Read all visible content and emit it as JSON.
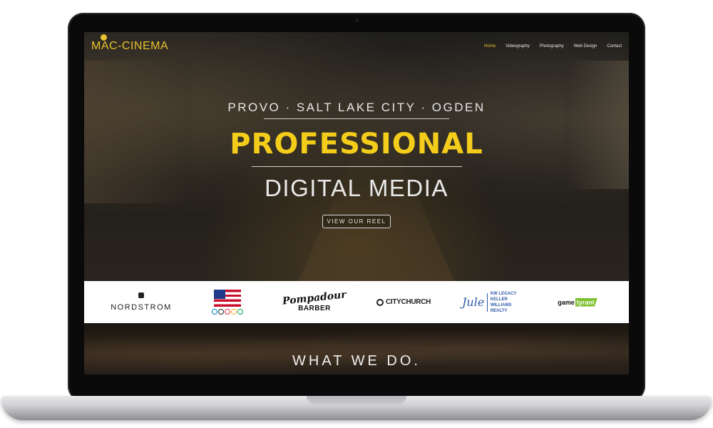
{
  "site": {
    "logo_text": "MAC-CINEMA",
    "nav": [
      {
        "label": "Home",
        "active": true
      },
      {
        "label": "Videography",
        "active": false
      },
      {
        "label": "Photography",
        "active": false
      },
      {
        "label": "Web Design",
        "active": false
      },
      {
        "label": "Contact",
        "active": false
      }
    ]
  },
  "hero": {
    "cities": "PROVO · SALT LAKE CITY · OGDEN",
    "headline": "PROFESSIONAL",
    "subhead": "DIGITAL MEDIA",
    "button_label": "VIEW OUR REEL"
  },
  "clients": {
    "nordstrom": "NORDSTROM",
    "barber_script": "Pompadour",
    "barber_word": "BARBER",
    "citychurch": "CITYCHURCH",
    "kw_sig": "Jule",
    "kw_line1": "KW LEGACY",
    "kw_line2": "KELLER WILLIAMS REALTY",
    "gt_game": "game",
    "gt_tyrant": "tyrant"
  },
  "section": {
    "title": "WHAT WE DO."
  },
  "colors": {
    "accent": "#f4cd1b",
    "bezel": "#0a0a0a"
  }
}
